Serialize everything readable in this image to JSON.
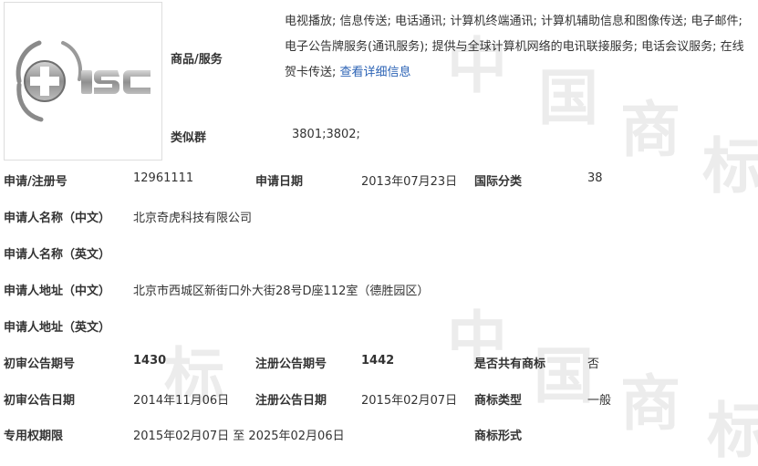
{
  "logo": {
    "icon": "isc-globe-cross-logo"
  },
  "goods_services": {
    "label": "商品/服务",
    "text": "电视播放; 信息传送; 电话通讯; 计算机终端通讯; 计算机辅助信息和图像传送; 电子邮件; 电子公告牌服务(通讯服务); 提供与全球计算机网络的电讯联接服务; 电话会议服务; 在线贺卡传送; ",
    "link_text": "查看详细信息"
  },
  "similar_group": {
    "label": "类似群",
    "value": "3801;3802;"
  },
  "reg_no": {
    "label": "申请/注册号",
    "value": "12961111"
  },
  "app_date": {
    "label": "申请日期",
    "value": "2013年07月23日"
  },
  "intl_class": {
    "label": "国际分类",
    "value": "38"
  },
  "applicant_cn": {
    "label": "申请人名称（中文）",
    "value": "北京奇虎科技有限公司"
  },
  "applicant_en": {
    "label": "申请人名称（英文）",
    "value": ""
  },
  "address_cn": {
    "label": "申请人地址（中文）",
    "value": "北京市西城区新街口外大街28号D座112室（德胜园区）"
  },
  "address_en": {
    "label": "申请人地址（英文）",
    "value": ""
  },
  "prelim_no": {
    "label": "初审公告期号",
    "value": "1430"
  },
  "reg_pub_no": {
    "label": "注册公告期号",
    "value": "1442"
  },
  "shared": {
    "label": "是否共有商标",
    "value": "否"
  },
  "prelim_date": {
    "label": "初审公告日期",
    "value": "2014年11月06日"
  },
  "reg_pub_date": {
    "label": "注册公告日期",
    "value": "2015年02月07日"
  },
  "tm_type": {
    "label": "商标类型",
    "value": "一般"
  },
  "exclusive": {
    "label": "专用权期限",
    "value": "2015年02月07日 至 2025年02月06日"
  },
  "tm_form": {
    "label": "商标形式",
    "value": ""
  },
  "watermark": {
    "chars": [
      "中",
      "国",
      "商",
      "标",
      "中",
      "国",
      "商",
      "标"
    ]
  }
}
